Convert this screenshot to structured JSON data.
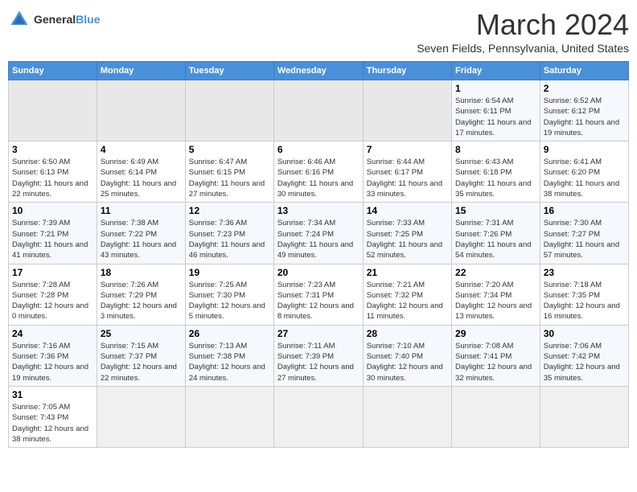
{
  "header": {
    "logo_general": "General",
    "logo_blue": "Blue",
    "month_title": "March 2024",
    "location": "Seven Fields, Pennsylvania, United States"
  },
  "days_of_week": [
    "Sunday",
    "Monday",
    "Tuesday",
    "Wednesday",
    "Thursday",
    "Friday",
    "Saturday"
  ],
  "weeks": [
    [
      {
        "day": "",
        "info": ""
      },
      {
        "day": "",
        "info": ""
      },
      {
        "day": "",
        "info": ""
      },
      {
        "day": "",
        "info": ""
      },
      {
        "day": "",
        "info": ""
      },
      {
        "day": "1",
        "info": "Sunrise: 6:54 AM\nSunset: 6:11 PM\nDaylight: 11 hours and 17 minutes."
      },
      {
        "day": "2",
        "info": "Sunrise: 6:52 AM\nSunset: 6:12 PM\nDaylight: 11 hours and 19 minutes."
      }
    ],
    [
      {
        "day": "3",
        "info": "Sunrise: 6:50 AM\nSunset: 6:13 PM\nDaylight: 11 hours and 22 minutes."
      },
      {
        "day": "4",
        "info": "Sunrise: 6:49 AM\nSunset: 6:14 PM\nDaylight: 11 hours and 25 minutes."
      },
      {
        "day": "5",
        "info": "Sunrise: 6:47 AM\nSunset: 6:15 PM\nDaylight: 11 hours and 27 minutes."
      },
      {
        "day": "6",
        "info": "Sunrise: 6:46 AM\nSunset: 6:16 PM\nDaylight: 11 hours and 30 minutes."
      },
      {
        "day": "7",
        "info": "Sunrise: 6:44 AM\nSunset: 6:17 PM\nDaylight: 11 hours and 33 minutes."
      },
      {
        "day": "8",
        "info": "Sunrise: 6:43 AM\nSunset: 6:18 PM\nDaylight: 11 hours and 35 minutes."
      },
      {
        "day": "9",
        "info": "Sunrise: 6:41 AM\nSunset: 6:20 PM\nDaylight: 11 hours and 38 minutes."
      }
    ],
    [
      {
        "day": "10",
        "info": "Sunrise: 7:39 AM\nSunset: 7:21 PM\nDaylight: 11 hours and 41 minutes."
      },
      {
        "day": "11",
        "info": "Sunrise: 7:38 AM\nSunset: 7:22 PM\nDaylight: 11 hours and 43 minutes."
      },
      {
        "day": "12",
        "info": "Sunrise: 7:36 AM\nSunset: 7:23 PM\nDaylight: 11 hours and 46 minutes."
      },
      {
        "day": "13",
        "info": "Sunrise: 7:34 AM\nSunset: 7:24 PM\nDaylight: 11 hours and 49 minutes."
      },
      {
        "day": "14",
        "info": "Sunrise: 7:33 AM\nSunset: 7:25 PM\nDaylight: 11 hours and 52 minutes."
      },
      {
        "day": "15",
        "info": "Sunrise: 7:31 AM\nSunset: 7:26 PM\nDaylight: 11 hours and 54 minutes."
      },
      {
        "day": "16",
        "info": "Sunrise: 7:30 AM\nSunset: 7:27 PM\nDaylight: 11 hours and 57 minutes."
      }
    ],
    [
      {
        "day": "17",
        "info": "Sunrise: 7:28 AM\nSunset: 7:28 PM\nDaylight: 12 hours and 0 minutes."
      },
      {
        "day": "18",
        "info": "Sunrise: 7:26 AM\nSunset: 7:29 PM\nDaylight: 12 hours and 3 minutes."
      },
      {
        "day": "19",
        "info": "Sunrise: 7:25 AM\nSunset: 7:30 PM\nDaylight: 12 hours and 5 minutes."
      },
      {
        "day": "20",
        "info": "Sunrise: 7:23 AM\nSunset: 7:31 PM\nDaylight: 12 hours and 8 minutes."
      },
      {
        "day": "21",
        "info": "Sunrise: 7:21 AM\nSunset: 7:32 PM\nDaylight: 12 hours and 11 minutes."
      },
      {
        "day": "22",
        "info": "Sunrise: 7:20 AM\nSunset: 7:34 PM\nDaylight: 12 hours and 13 minutes."
      },
      {
        "day": "23",
        "info": "Sunrise: 7:18 AM\nSunset: 7:35 PM\nDaylight: 12 hours and 16 minutes."
      }
    ],
    [
      {
        "day": "24",
        "info": "Sunrise: 7:16 AM\nSunset: 7:36 PM\nDaylight: 12 hours and 19 minutes."
      },
      {
        "day": "25",
        "info": "Sunrise: 7:15 AM\nSunset: 7:37 PM\nDaylight: 12 hours and 22 minutes."
      },
      {
        "day": "26",
        "info": "Sunrise: 7:13 AM\nSunset: 7:38 PM\nDaylight: 12 hours and 24 minutes."
      },
      {
        "day": "27",
        "info": "Sunrise: 7:11 AM\nSunset: 7:39 PM\nDaylight: 12 hours and 27 minutes."
      },
      {
        "day": "28",
        "info": "Sunrise: 7:10 AM\nSunset: 7:40 PM\nDaylight: 12 hours and 30 minutes."
      },
      {
        "day": "29",
        "info": "Sunrise: 7:08 AM\nSunset: 7:41 PM\nDaylight: 12 hours and 32 minutes."
      },
      {
        "day": "30",
        "info": "Sunrise: 7:06 AM\nSunset: 7:42 PM\nDaylight: 12 hours and 35 minutes."
      }
    ],
    [
      {
        "day": "31",
        "info": "Sunrise: 7:05 AM\nSunset: 7:43 PM\nDaylight: 12 hours and 38 minutes."
      },
      {
        "day": "",
        "info": ""
      },
      {
        "day": "",
        "info": ""
      },
      {
        "day": "",
        "info": ""
      },
      {
        "day": "",
        "info": ""
      },
      {
        "day": "",
        "info": ""
      },
      {
        "day": "",
        "info": ""
      }
    ]
  ]
}
